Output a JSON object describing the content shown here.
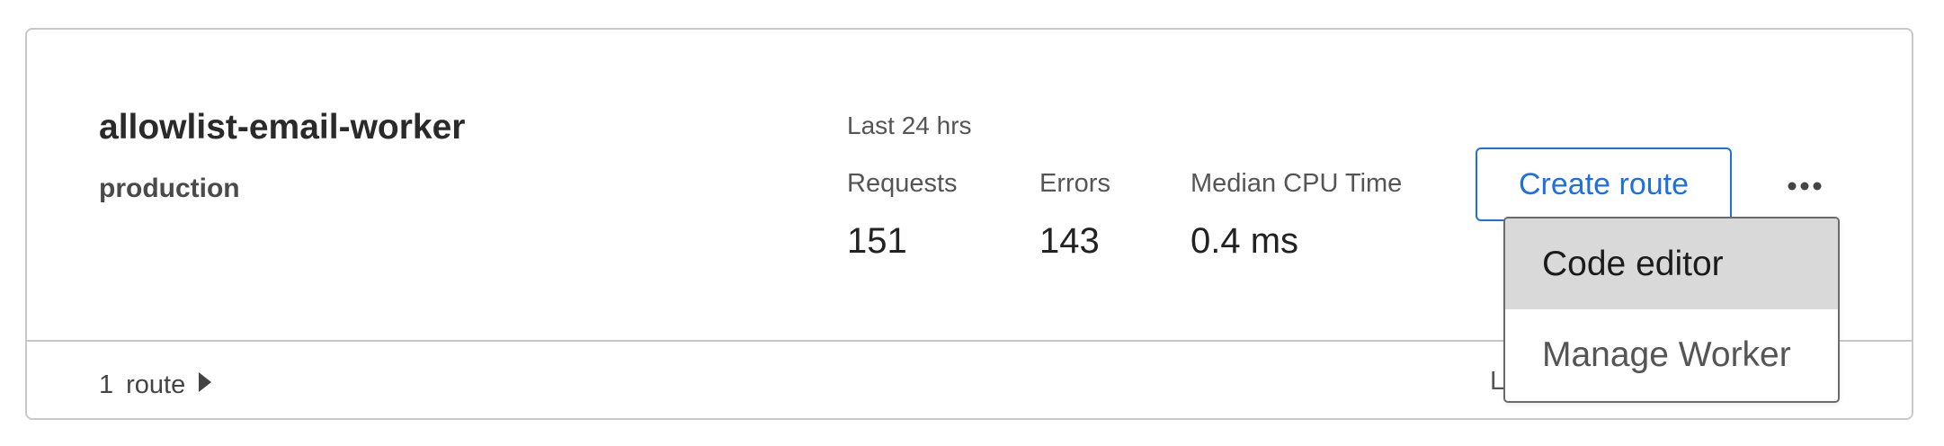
{
  "worker": {
    "name": "allowlist-email-worker",
    "environment": "production"
  },
  "metrics": {
    "period": "Last 24 hrs",
    "requests": {
      "label": "Requests",
      "value": "151"
    },
    "errors": {
      "label": "Errors",
      "value": "143"
    },
    "cpu": {
      "label": "Median CPU Time",
      "value": "0.4 ms"
    }
  },
  "actions": {
    "create_route_label": "Create route",
    "more_icon": "more-horizontal-icon"
  },
  "footer": {
    "route_count": "1",
    "route_label": "route",
    "clipped_text": "L"
  },
  "dropdown": {
    "items": [
      {
        "label": "Code editor",
        "highlighted": true
      },
      {
        "label": "Manage Worker",
        "highlighted": false
      }
    ]
  },
  "colors": {
    "accent": "#1f6fe0",
    "border": "#c8c8c8",
    "menu_highlight": "#d9d9d9"
  }
}
